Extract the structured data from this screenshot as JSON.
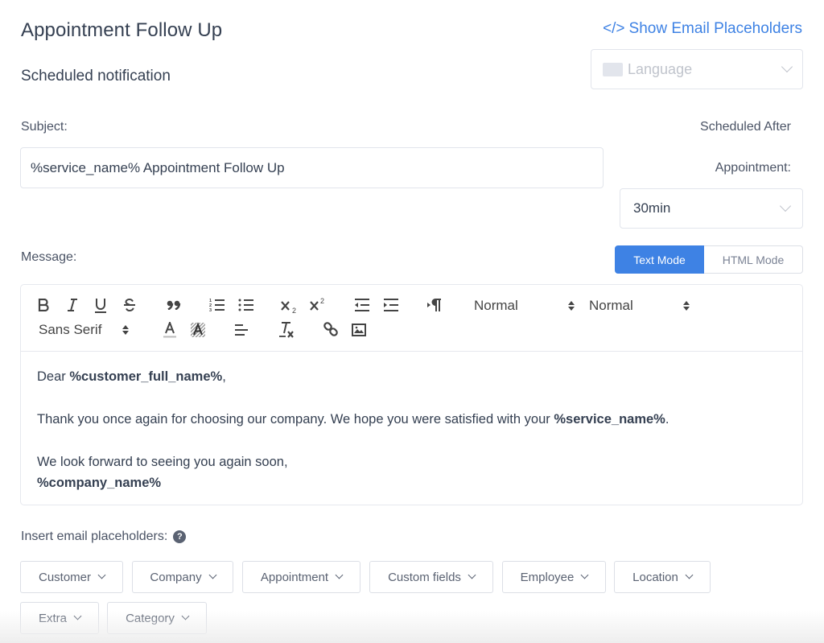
{
  "header": {
    "title": "Appointment Follow Up",
    "subtitle": "Scheduled notification",
    "show_placeholders_icon": "</>",
    "show_placeholders_label": "Show Email Placeholders",
    "language_placeholder": "Language"
  },
  "subject": {
    "label": "Subject:",
    "value": "%service_name% Appointment Follow Up"
  },
  "schedule": {
    "label_line1": "Scheduled After",
    "label_line2": "Appointment:",
    "value": "30min"
  },
  "message": {
    "label": "Message:",
    "modes": [
      {
        "label": "Text Mode",
        "active": true
      },
      {
        "label": "HTML Mode",
        "active": false
      }
    ],
    "toolbar": {
      "header_picker": "Normal",
      "size_picker": "Normal",
      "font_picker": "Sans Serif",
      "buttons": [
        "bold-icon",
        "italic-icon",
        "underline-icon",
        "strike-icon",
        "blockquote-icon",
        "ordered-list-icon",
        "bullet-list-icon",
        "subscript-icon",
        "superscript-icon",
        "outdent-icon",
        "indent-icon",
        "rtl-direction-icon",
        "font-color-icon",
        "background-color-icon",
        "align-left-icon",
        "clear-format-icon",
        "link-icon",
        "image-icon"
      ]
    },
    "body": {
      "greeting_prefix": "Dear ",
      "greeting_placeholder": "%customer_full_name%",
      "greeting_suffix": ",",
      "line2_prefix": "Thank you once again for choosing our company. We hope you were satisfied with your ",
      "line2_placeholder": "%service_name%",
      "line2_suffix": ".",
      "line3": "We look forward to seeing you again soon,",
      "signature": "%company_name%"
    }
  },
  "placeholders": {
    "label": "Insert email placeholders:",
    "help_icon": "?",
    "groups": [
      "Customer",
      "Company",
      "Appointment",
      "Custom fields",
      "Employee",
      "Location",
      "Extra",
      "Category"
    ]
  },
  "colors": {
    "accent": "#3e82e4",
    "text": "#354052",
    "border": "#e2e5ec"
  }
}
